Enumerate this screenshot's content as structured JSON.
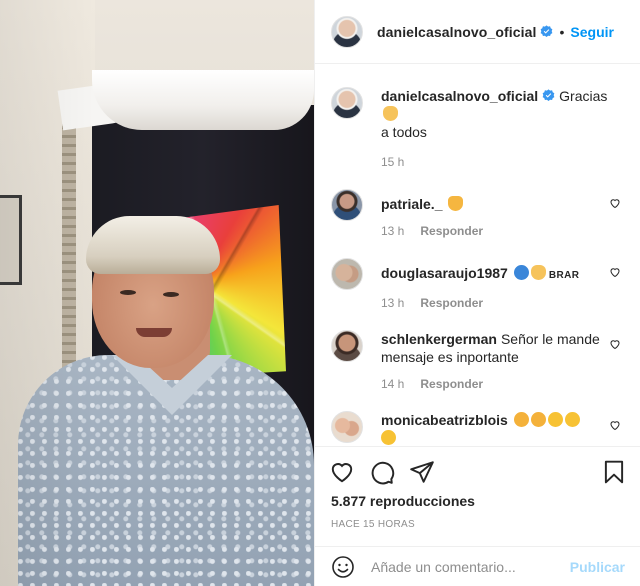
{
  "post": {
    "author": "danielcasalnovo_oficial",
    "follow_label": "Seguir",
    "separator": "•"
  },
  "caption": {
    "username": "danielcasalnovo_oficial",
    "text": "Gracias",
    "emoji": "folded-hands-emoji",
    "text2": "a todos",
    "time": "15 h"
  },
  "comments": [
    {
      "username": "patriale._",
      "text": "",
      "emojis": [
        "raising-hands-emoji"
      ],
      "time": "13 h",
      "reply_label": "Responder"
    },
    {
      "username": "douglasaraujo1987",
      "text": "",
      "emojis": [
        "blue-heart-emoji",
        "folded-hands-emoji"
      ],
      "extra": "BRAR",
      "time": "13 h",
      "reply_label": "Responder"
    },
    {
      "username": "schlenkergerman",
      "text": "Señor le mande mensaje es inportante",
      "time": "14 h",
      "reply_label": "Responder"
    },
    {
      "username": "monicabeatrizblois",
      "text": "",
      "emojis": [
        "clapping-hands-emoji",
        "clapping-hands-emoji",
        "face-blowing-kiss-emoji",
        "face-blowing-kiss-emoji",
        "face-blowing-kiss-emoji"
      ]
    }
  ],
  "stats": {
    "views": "5.877 reproducciones",
    "ago": "HACE 15 HORAS"
  },
  "composer": {
    "placeholder": "Añade un comentario...",
    "publish_label": "Publicar"
  },
  "colors": {
    "accent": "#0095f6",
    "text": "#262626",
    "muted": "#8e8e8e",
    "border": "#efefef"
  }
}
